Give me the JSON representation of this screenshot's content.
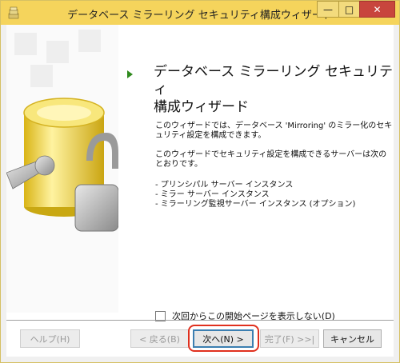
{
  "window": {
    "title": "データベース ミラーリング セキュリティ構成ウィザード",
    "controls": {
      "minimize": "—",
      "maximize": "□",
      "close": "✕"
    }
  },
  "main": {
    "heading_line1": "データベース ミラーリング セキュリティ",
    "heading_line2": "構成ウィザード",
    "intro_line1": "このウィザードでは、データベース 'Mirroring' のミラー化のセキ",
    "intro_line2": "ュリティ設定を構成できます。",
    "servers_line1": "このウィザードでセキュリティ設定を構成できるサーバーは次の",
    "servers_line2": "とおりです。",
    "server_items": [
      "- プリンシパル サーバー インスタンス",
      "- ミラー サーバー インスタンス",
      "- ミラーリング監視サーバー インスタンス (オプション)"
    ],
    "skip_checkbox_label": "次回からこの開始ページを表示しない(D)"
  },
  "buttons": {
    "help": "ヘルプ(H)",
    "back": "< 戻る(B)",
    "next": "次へ(N) >",
    "finish": "完了(F) >>|",
    "cancel": "キャンセル"
  },
  "colors": {
    "titlebar": "#f5d45c",
    "close_button": "#c8453d",
    "arrow": "#2f8a1e",
    "highlight": "#e0301e"
  },
  "icons": {
    "app": "database-icon",
    "arrow": "green-triangle-icon",
    "illustration": "database-wrench-padlock-illustration"
  }
}
